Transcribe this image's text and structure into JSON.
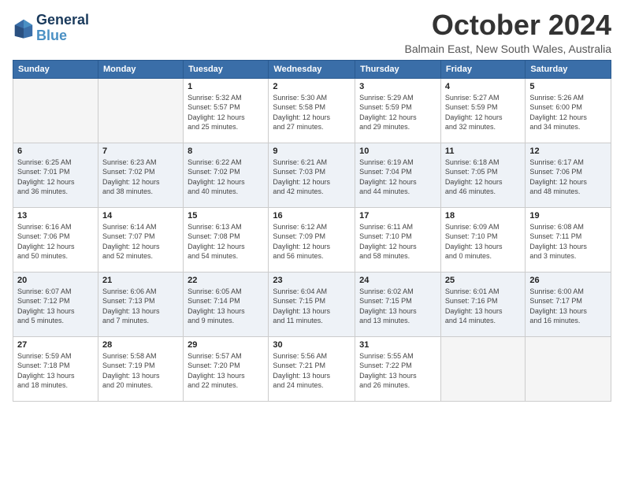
{
  "logo": {
    "line1": "General",
    "line2": "Blue"
  },
  "title": "October 2024",
  "subtitle": "Balmain East, New South Wales, Australia",
  "weekdays": [
    "Sunday",
    "Monday",
    "Tuesday",
    "Wednesday",
    "Thursday",
    "Friday",
    "Saturday"
  ],
  "weeks": [
    [
      {
        "day": "",
        "info": ""
      },
      {
        "day": "",
        "info": ""
      },
      {
        "day": "1",
        "info": "Sunrise: 5:32 AM\nSunset: 5:57 PM\nDaylight: 12 hours\nand 25 minutes."
      },
      {
        "day": "2",
        "info": "Sunrise: 5:30 AM\nSunset: 5:58 PM\nDaylight: 12 hours\nand 27 minutes."
      },
      {
        "day": "3",
        "info": "Sunrise: 5:29 AM\nSunset: 5:59 PM\nDaylight: 12 hours\nand 29 minutes."
      },
      {
        "day": "4",
        "info": "Sunrise: 5:27 AM\nSunset: 5:59 PM\nDaylight: 12 hours\nand 32 minutes."
      },
      {
        "day": "5",
        "info": "Sunrise: 5:26 AM\nSunset: 6:00 PM\nDaylight: 12 hours\nand 34 minutes."
      }
    ],
    [
      {
        "day": "6",
        "info": "Sunrise: 6:25 AM\nSunset: 7:01 PM\nDaylight: 12 hours\nand 36 minutes."
      },
      {
        "day": "7",
        "info": "Sunrise: 6:23 AM\nSunset: 7:02 PM\nDaylight: 12 hours\nand 38 minutes."
      },
      {
        "day": "8",
        "info": "Sunrise: 6:22 AM\nSunset: 7:02 PM\nDaylight: 12 hours\nand 40 minutes."
      },
      {
        "day": "9",
        "info": "Sunrise: 6:21 AM\nSunset: 7:03 PM\nDaylight: 12 hours\nand 42 minutes."
      },
      {
        "day": "10",
        "info": "Sunrise: 6:19 AM\nSunset: 7:04 PM\nDaylight: 12 hours\nand 44 minutes."
      },
      {
        "day": "11",
        "info": "Sunrise: 6:18 AM\nSunset: 7:05 PM\nDaylight: 12 hours\nand 46 minutes."
      },
      {
        "day": "12",
        "info": "Sunrise: 6:17 AM\nSunset: 7:06 PM\nDaylight: 12 hours\nand 48 minutes."
      }
    ],
    [
      {
        "day": "13",
        "info": "Sunrise: 6:16 AM\nSunset: 7:06 PM\nDaylight: 12 hours\nand 50 minutes."
      },
      {
        "day": "14",
        "info": "Sunrise: 6:14 AM\nSunset: 7:07 PM\nDaylight: 12 hours\nand 52 minutes."
      },
      {
        "day": "15",
        "info": "Sunrise: 6:13 AM\nSunset: 7:08 PM\nDaylight: 12 hours\nand 54 minutes."
      },
      {
        "day": "16",
        "info": "Sunrise: 6:12 AM\nSunset: 7:09 PM\nDaylight: 12 hours\nand 56 minutes."
      },
      {
        "day": "17",
        "info": "Sunrise: 6:11 AM\nSunset: 7:10 PM\nDaylight: 12 hours\nand 58 minutes."
      },
      {
        "day": "18",
        "info": "Sunrise: 6:09 AM\nSunset: 7:10 PM\nDaylight: 13 hours\nand 0 minutes."
      },
      {
        "day": "19",
        "info": "Sunrise: 6:08 AM\nSunset: 7:11 PM\nDaylight: 13 hours\nand 3 minutes."
      }
    ],
    [
      {
        "day": "20",
        "info": "Sunrise: 6:07 AM\nSunset: 7:12 PM\nDaylight: 13 hours\nand 5 minutes."
      },
      {
        "day": "21",
        "info": "Sunrise: 6:06 AM\nSunset: 7:13 PM\nDaylight: 13 hours\nand 7 minutes."
      },
      {
        "day": "22",
        "info": "Sunrise: 6:05 AM\nSunset: 7:14 PM\nDaylight: 13 hours\nand 9 minutes."
      },
      {
        "day": "23",
        "info": "Sunrise: 6:04 AM\nSunset: 7:15 PM\nDaylight: 13 hours\nand 11 minutes."
      },
      {
        "day": "24",
        "info": "Sunrise: 6:02 AM\nSunset: 7:15 PM\nDaylight: 13 hours\nand 13 minutes."
      },
      {
        "day": "25",
        "info": "Sunrise: 6:01 AM\nSunset: 7:16 PM\nDaylight: 13 hours\nand 14 minutes."
      },
      {
        "day": "26",
        "info": "Sunrise: 6:00 AM\nSunset: 7:17 PM\nDaylight: 13 hours\nand 16 minutes."
      }
    ],
    [
      {
        "day": "27",
        "info": "Sunrise: 5:59 AM\nSunset: 7:18 PM\nDaylight: 13 hours\nand 18 minutes."
      },
      {
        "day": "28",
        "info": "Sunrise: 5:58 AM\nSunset: 7:19 PM\nDaylight: 13 hours\nand 20 minutes."
      },
      {
        "day": "29",
        "info": "Sunrise: 5:57 AM\nSunset: 7:20 PM\nDaylight: 13 hours\nand 22 minutes."
      },
      {
        "day": "30",
        "info": "Sunrise: 5:56 AM\nSunset: 7:21 PM\nDaylight: 13 hours\nand 24 minutes."
      },
      {
        "day": "31",
        "info": "Sunrise: 5:55 AM\nSunset: 7:22 PM\nDaylight: 13 hours\nand 26 minutes."
      },
      {
        "day": "",
        "info": ""
      },
      {
        "day": "",
        "info": ""
      }
    ]
  ]
}
